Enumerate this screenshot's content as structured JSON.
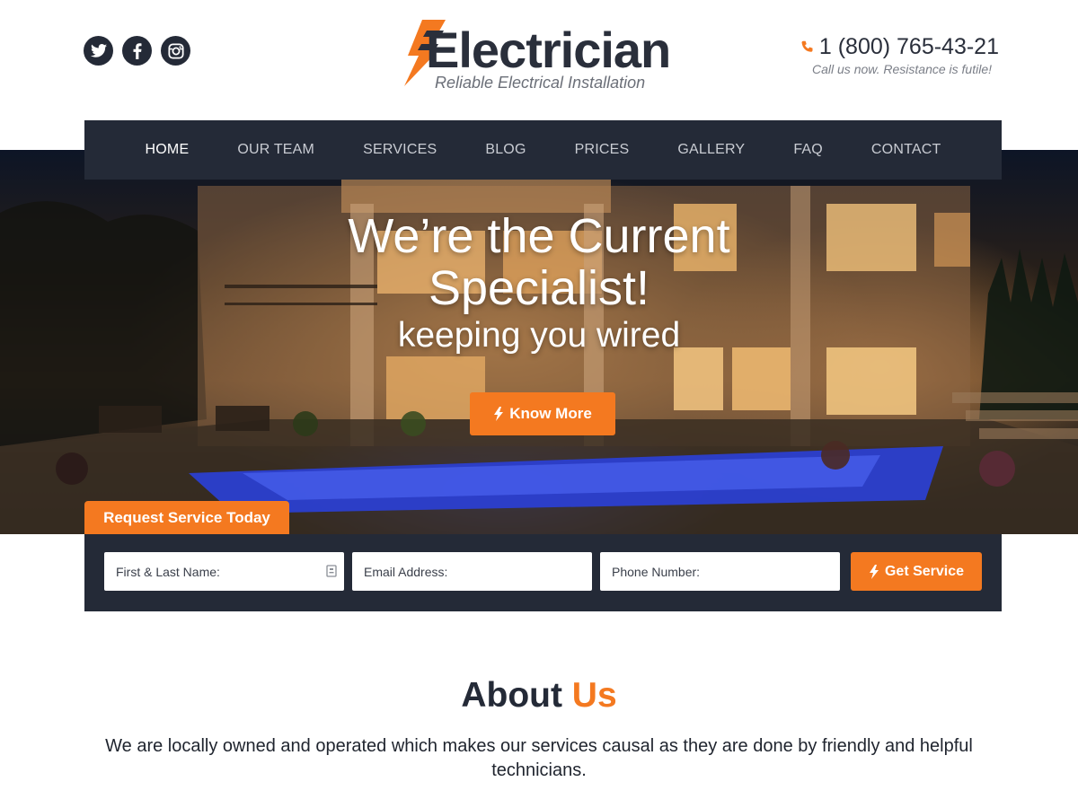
{
  "header": {
    "social": [
      {
        "name": "twitter-icon"
      },
      {
        "name": "facebook-icon"
      },
      {
        "name": "instagram-icon"
      }
    ],
    "logo": {
      "title": "Electrician",
      "subtitle": "Reliable Electrical Installation"
    },
    "contact": {
      "phone": "1 (800) 765-43-21",
      "note": "Call us now. Resistance is futile!"
    }
  },
  "nav": {
    "items": [
      "HOME",
      "OUR TEAM",
      "SERVICES",
      "BLOG",
      "PRICES",
      "GALLERY",
      "FAQ",
      "CONTACT"
    ],
    "active": "HOME"
  },
  "hero": {
    "title_line1": "We’re the Current",
    "title_line2": "Specialist!",
    "subtitle": "keeping you wired",
    "button": "Know More"
  },
  "request": {
    "tab_label": "Request Service Today",
    "fields": {
      "name_placeholder": "First & Last Name:",
      "email_placeholder": "Email Address:",
      "phone_placeholder": "Phone Number:"
    },
    "submit": "Get Service"
  },
  "about": {
    "title_part1": "About",
    "title_part2": "Us",
    "text": "We are locally owned and operated which makes our services causal as they are done by friendly and helpful technicians."
  },
  "colors": {
    "accent": "#f47920",
    "dark": "#242a37"
  }
}
